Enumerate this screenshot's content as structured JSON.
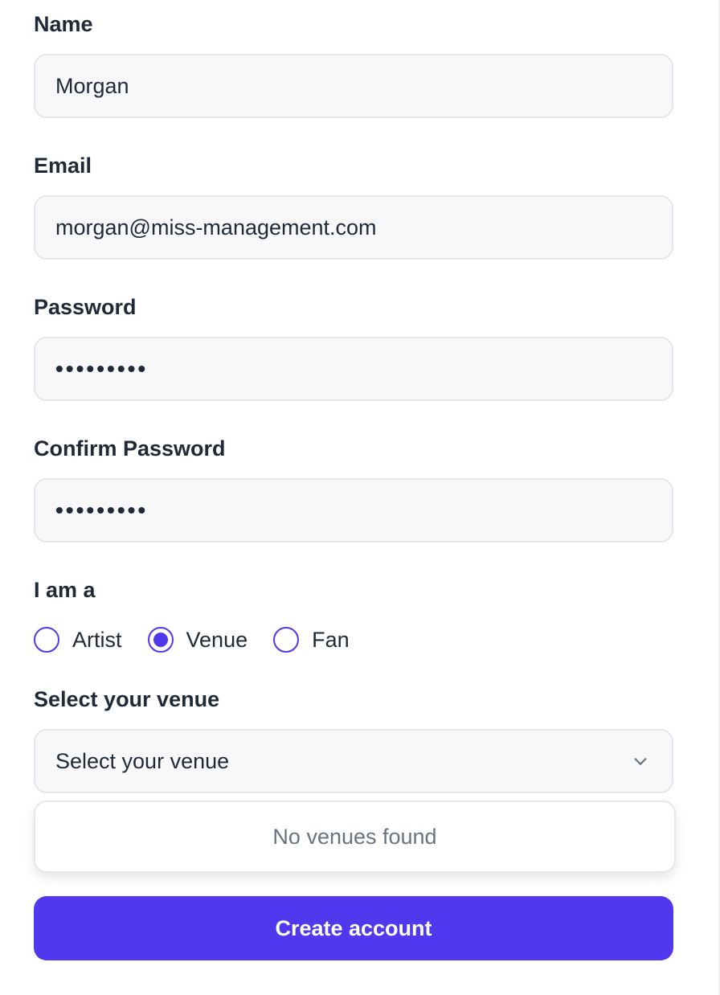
{
  "form": {
    "name": {
      "label": "Name",
      "value": "Morgan"
    },
    "email": {
      "label": "Email",
      "value": "morgan@miss-management.com"
    },
    "password": {
      "label": "Password",
      "value": "•••••••••"
    },
    "confirm_password": {
      "label": "Confirm Password",
      "value": "•••••••••"
    },
    "role": {
      "label": "I am a",
      "options": [
        {
          "label": "Artist",
          "selected": false
        },
        {
          "label": "Venue",
          "selected": true
        },
        {
          "label": "Fan",
          "selected": false
        }
      ]
    },
    "venue": {
      "label": "Select your venue",
      "placeholder": "Select your venue",
      "empty_message": "No venues found"
    },
    "submit_label": "Create account"
  },
  "colors": {
    "accent": "#5138ee",
    "field_bg": "#f8f8fb",
    "field_border": "#e5e7eb",
    "muted_text": "#6b7280"
  },
  "icons": {
    "select_toggle": "chevron-down-icon"
  }
}
